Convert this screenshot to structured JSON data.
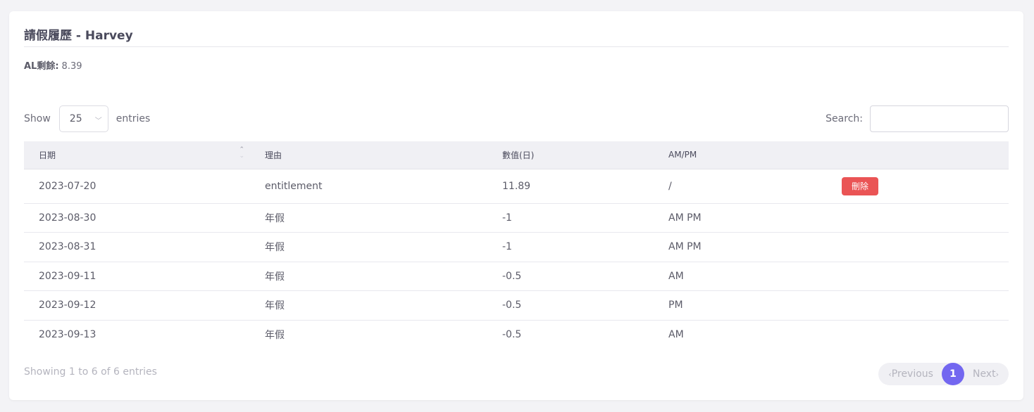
{
  "card": {
    "title": "請假履歷 - Harvey",
    "balance_label": "AL剩餘:",
    "balance_value": "8.39"
  },
  "length_menu": {
    "show_label": "Show",
    "selected": "25",
    "entries_label": "entries"
  },
  "search": {
    "label": "Search:",
    "value": "",
    "placeholder": ""
  },
  "table": {
    "columns": [
      "日期",
      "理由",
      "數值(日)",
      "AM/PM",
      ""
    ],
    "rows": [
      {
        "date": "2023-07-20",
        "reason": "entitlement",
        "value": "11.89",
        "ampm": "/",
        "action": "刪除"
      },
      {
        "date": "2023-08-30",
        "reason": "年假",
        "value": "-1",
        "ampm": "AM PM",
        "action": ""
      },
      {
        "date": "2023-08-31",
        "reason": "年假",
        "value": "-1",
        "ampm": "AM PM",
        "action": ""
      },
      {
        "date": "2023-09-11",
        "reason": "年假",
        "value": "-0.5",
        "ampm": "AM",
        "action": ""
      },
      {
        "date": "2023-09-12",
        "reason": "年假",
        "value": "-0.5",
        "ampm": "PM",
        "action": ""
      },
      {
        "date": "2023-09-13",
        "reason": "年假",
        "value": "-0.5",
        "ampm": "AM",
        "action": ""
      }
    ]
  },
  "footer": {
    "info": "Showing 1 to 6 of 6 entries",
    "prev_label": "Previous",
    "current_page": "1",
    "next_label": "Next"
  },
  "colors": {
    "accent": "#7367f0",
    "danger": "#ea5455",
    "header_bg": "#f0f0f4"
  }
}
